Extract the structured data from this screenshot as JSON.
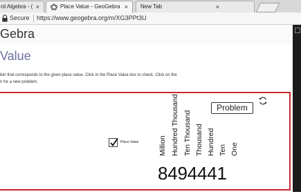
{
  "browser": {
    "tabs": [
      {
        "label": "rd Algebra - ( ",
        "close": "×",
        "active": false
      },
      {
        "label": "Place Value - GeoGebra",
        "close": "×",
        "active": true,
        "icon": "geogebra-icon"
      },
      {
        "label": "New Tab",
        "close": "×",
        "active": false
      }
    ],
    "security_label": "Secure",
    "url": "https://www.geogebra.org/m/XG3PPt3U"
  },
  "page": {
    "site_title": "Gebra",
    "title": "Value",
    "instructions_line1": "ber that corresponds to the given place value.  Click in the Place Value box to check.  Click on the",
    "instructions_line2": "n for a new problem."
  },
  "applet": {
    "problem_button": "Problem",
    "checkbox": {
      "label": "Place Value",
      "checked": true
    },
    "place_values": [
      "Million",
      "Hundred Thousand",
      "Ten Thousand",
      "Thousand",
      "Hundred",
      "Ten",
      "One"
    ],
    "number": "8494441",
    "refresh_icon": "refresh-icon",
    "border_color": "#c7282e"
  }
}
